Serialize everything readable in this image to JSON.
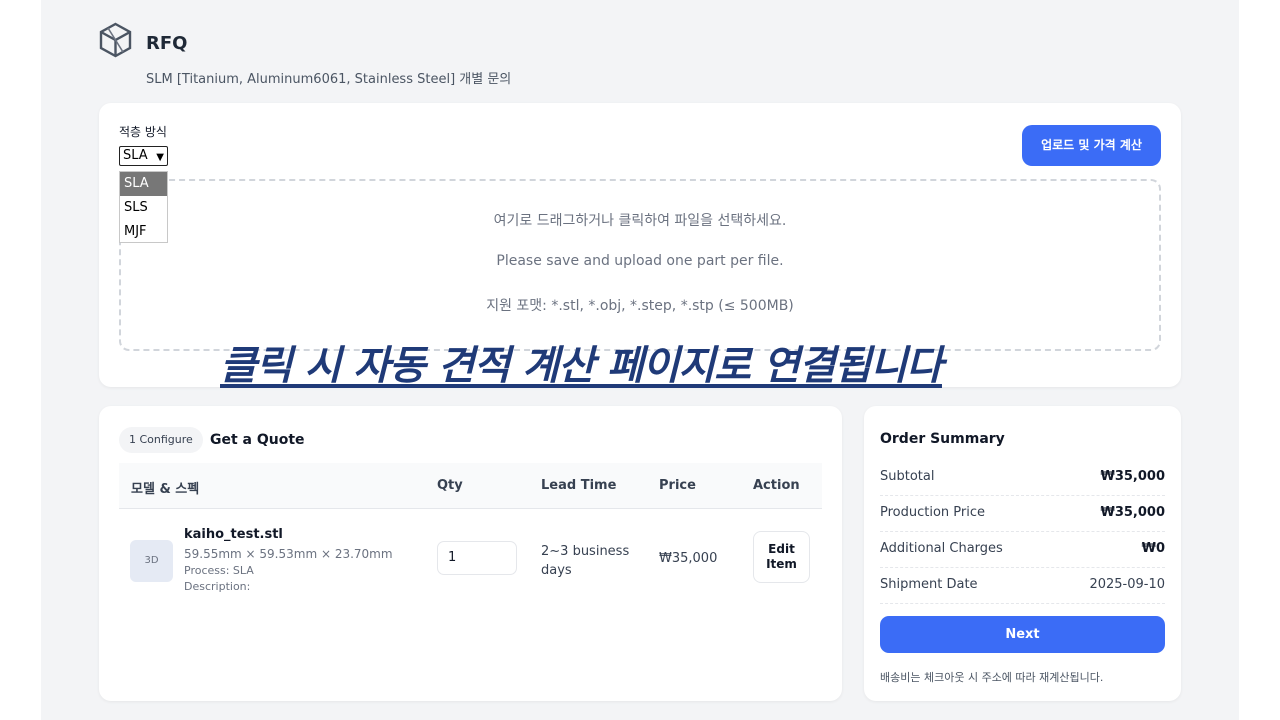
{
  "header": {
    "title": "RFQ",
    "subtitle": "SLM [Titanium, Aluminum6061, Stainless Steel] 개별 문의"
  },
  "upload": {
    "method_label": "적층 방식",
    "method_selected": "SLA",
    "method_options": [
      "SLA",
      "SLS",
      "MJF"
    ],
    "upload_button": "업로드 및 가격 계산",
    "dropzone_lines": [
      "여기로 드래그하거나 클릭하여 파일을 선택하세요.",
      "Please save and upload one part per file.",
      "지원 포맷: *.stl, *.obj, *.step, *.stp (≤ 500MB)"
    ]
  },
  "overlay_caption": "클릭 시 자동 견적 계산 페이지로 연결됩니다",
  "quote": {
    "step_label": "1 Configure",
    "title": "Get a Quote",
    "columns": [
      "모델 & 스펙",
      "Qty",
      "Lead Time",
      "Price",
      "Action"
    ],
    "items": [
      {
        "thumb": "3D",
        "filename": "kaiho_test.stl",
        "dimensions": "59.55mm × 59.53mm × 23.70mm",
        "process": "Process: SLA",
        "description": "Description:",
        "qty": "1",
        "lead_time": "2~3 business days",
        "price": "₩35,000",
        "action": "Edit Item"
      }
    ]
  },
  "summary": {
    "title": "Order Summary",
    "rows": [
      {
        "label": "Subtotal",
        "value": "₩35,000",
        "bold": true
      },
      {
        "label": "Production Price",
        "value": "₩35,000",
        "bold": true
      },
      {
        "label": "Additional Charges",
        "value": "₩0",
        "bold": true
      },
      {
        "label": "Shipment Date",
        "value": "2025-09-10",
        "bold": false
      }
    ],
    "next_button": "Next",
    "note": "배송비는 체크아웃 시 주소에 따라 재계산됩니다."
  },
  "colors": {
    "accent": "#3b6cf6",
    "overlay": "#1f3a78",
    "page_bg": "#f3f4f6"
  }
}
